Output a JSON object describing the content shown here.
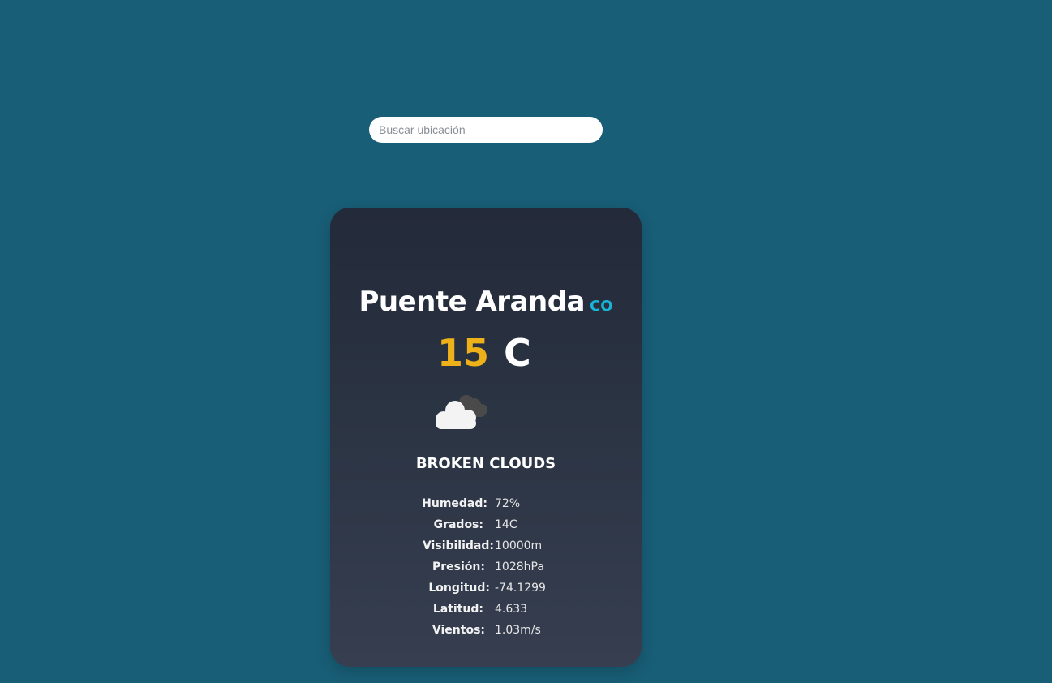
{
  "search": {
    "placeholder": "Buscar ubicación",
    "value": ""
  },
  "weather": {
    "city": "Puente Aranda",
    "country": "CO",
    "temperature": "15",
    "unit": "C",
    "icon": "broken-clouds-icon",
    "description": "BROKEN CLOUDS",
    "details": [
      {
        "label": "Humedad:",
        "value": "72%"
      },
      {
        "label": "Grados:",
        "value": "14C"
      },
      {
        "label": "Visibilidad:",
        "value": "10000m"
      },
      {
        "label": "Presión:",
        "value": "1028hPa"
      },
      {
        "label": "Longitud:",
        "value": "-74.1299"
      },
      {
        "label": "Latitud:",
        "value": "4.633"
      },
      {
        "label": "Vientos:",
        "value": "1.03m/s"
      }
    ]
  },
  "colors": {
    "background": "#185e76",
    "card_top": "#232a3a",
    "card_bottom": "#363e50",
    "temperature": "#eeb11a",
    "country": "#19b3d8"
  }
}
